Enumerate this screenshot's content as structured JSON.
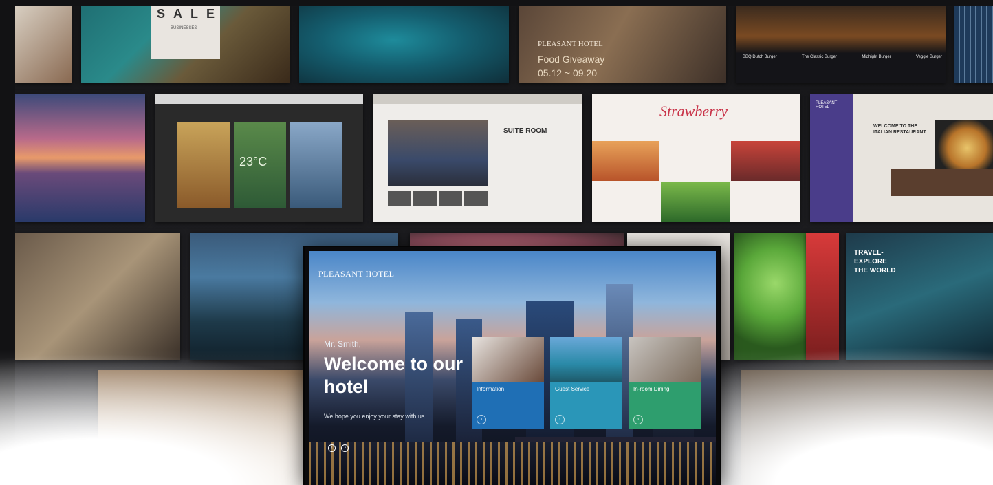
{
  "tiles": {
    "sale_heading": "SALE",
    "sale_sub": "BUSINESSES",
    "food_brand": "PLEASANT HOTEL",
    "food_title": "Food Giveaway",
    "food_dates": "05.12 ~ 09.20",
    "burgers": [
      "BBQ Dutch Burger",
      "The Classic Burger",
      "Midnight Burger",
      "Veggie Burger"
    ],
    "suite_title": "SUITE ROOM",
    "strawberry_logo": "Strawberry",
    "italian_brand": "PLEASANT HOTEL",
    "italian_title": "WELCOME TO THE ITALIAN RESTAURANT",
    "weather_temp": "23°C",
    "travel": [
      "TRAVEL-",
      "EXPLORE",
      "THE WORLD"
    ]
  },
  "screen": {
    "brand": "PLEASANT HOTEL",
    "greeting": "Mr. Smith,",
    "headline": "Welcome to our hotel",
    "subtitle": "We hope you enjoy your stay with us",
    "cards": [
      {
        "label": "Information",
        "color": "#1f6fb5"
      },
      {
        "label": "Guest Service",
        "color": "#2a96b8"
      },
      {
        "label": "In-room Dining",
        "color": "#2e9e6e"
      }
    ]
  },
  "colors": {
    "accent_blue": "#1f6fb5",
    "accent_teal": "#2a96b8",
    "accent_green": "#2e9e6e",
    "background": "#1c1c1e"
  }
}
